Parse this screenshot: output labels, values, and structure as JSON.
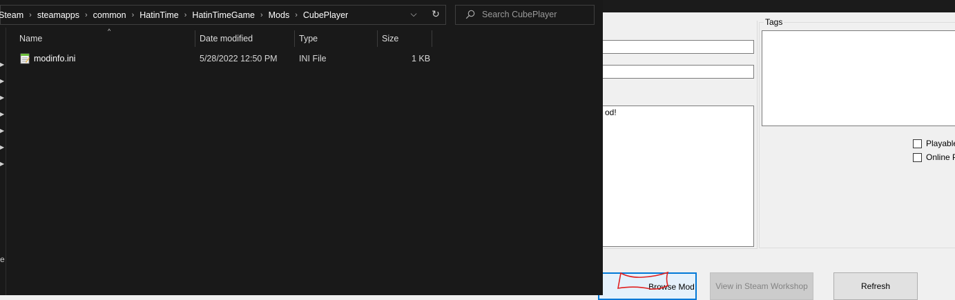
{
  "explorer": {
    "breadcrumbs": [
      "Steam",
      "steamapps",
      "common",
      "HatinTime",
      "HatinTimeGame",
      "Mods",
      "CubePlayer"
    ],
    "search": {
      "placeholder": "Search CubePlayer"
    },
    "columns": {
      "name": "Name",
      "date": "Date modified",
      "type": "Type",
      "size": "Size"
    },
    "files": [
      {
        "name": "modinfo.ini",
        "date": "5/28/2022 12:50 PM",
        "type": "INI File",
        "size": "1 KB"
      }
    ],
    "nav_partial_text": "e"
  },
  "background_app": {
    "description_partial": "od!",
    "tags_label": "Tags",
    "checkboxes": [
      "Playable",
      "Online Pa"
    ],
    "buttons": {
      "browse_mod": "Browse Mod",
      "view_workshop": "View in Steam Workshop",
      "refresh": "Refresh"
    }
  },
  "colors": {
    "explorer_bg": "#191919",
    "accent": "#0078d7",
    "annotation": "#e02020"
  }
}
